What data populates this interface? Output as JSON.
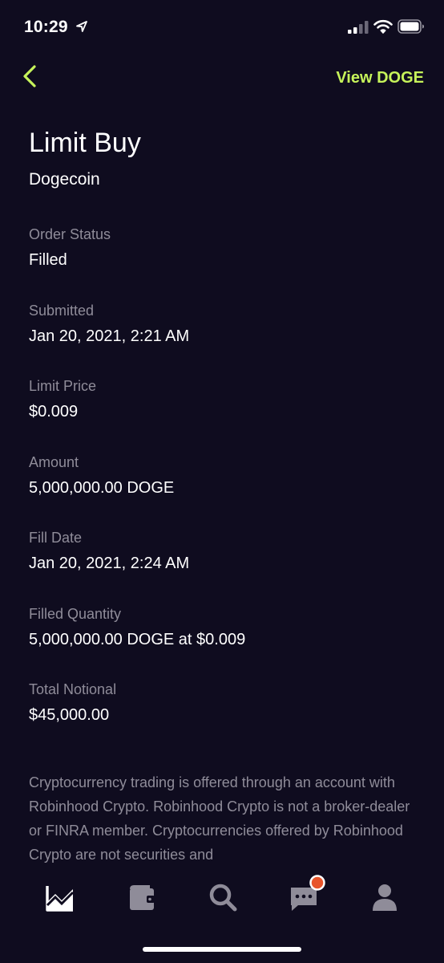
{
  "status_bar": {
    "time": "10:29"
  },
  "nav": {
    "view_link": "View DOGE"
  },
  "header": {
    "title": "Limit Buy",
    "subtitle": "Dogecoin"
  },
  "details": [
    {
      "label": "Order Status",
      "value": "Filled"
    },
    {
      "label": "Submitted",
      "value": "Jan 20, 2021, 2:21 AM"
    },
    {
      "label": "Limit Price",
      "value": "$0.009"
    },
    {
      "label": "Amount",
      "value": "5,000,000.00 DOGE"
    },
    {
      "label": "Fill Date",
      "value": "Jan 20, 2021, 2:24 AM"
    },
    {
      "label": "Filled Quantity",
      "value": "5,000,000.00 DOGE at $0.009"
    },
    {
      "label": "Total Notional",
      "value": "$45,000.00"
    }
  ],
  "disclaimer": "Cryptocurrency trading is offered through an account with Robinhood Crypto. Robinhood Crypto is not a broker-dealer or FINRA member. Cryptocurrencies offered by Robinhood Crypto are not securities and",
  "tab_bar": {
    "tabs": [
      "chart-icon",
      "wallet-icon",
      "search-icon",
      "messages-icon",
      "profile-icon"
    ],
    "notification_color": "#e8542a"
  },
  "colors": {
    "background": "#0f0c1f",
    "accent": "#c6f35a",
    "muted": "#8f8c99",
    "inactive_icon": "#8f8c99"
  }
}
